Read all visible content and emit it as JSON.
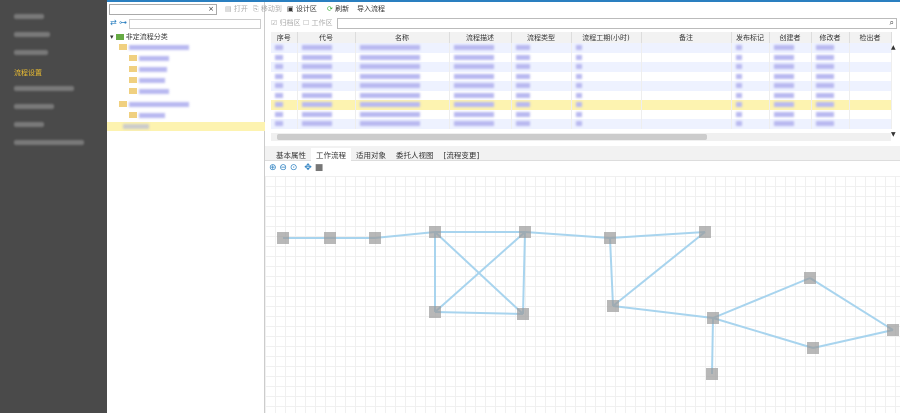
{
  "sidebar": {
    "active_item": "流程设置",
    "accent": "#f0c030"
  },
  "tree": {
    "root": "非定流程分类",
    "combo_clear": "×"
  },
  "toolbar": {
    "open": "打开",
    "move": "移动到",
    "design": "设计区",
    "refresh": "刷新",
    "import": "导入流程"
  },
  "filter": {
    "archive": "归档区",
    "work": "工作区"
  },
  "table": {
    "columns": [
      "序号",
      "代号",
      "名称",
      "流程描述",
      "流程类型",
      "流程工期(小时)",
      "备注",
      "发布标记",
      "创建者",
      "修改者",
      "检出者"
    ],
    "row_count": 9,
    "selected_row": 6
  },
  "tabs": [
    "基本属性",
    "工作流程",
    "适用对象",
    "委托人视图",
    "[流程变更]"
  ],
  "active_tab": "工作流程",
  "colors": {
    "line": "#a8d4ee",
    "node": "#9a9a9a",
    "selected_row": "#fdf3b0"
  }
}
